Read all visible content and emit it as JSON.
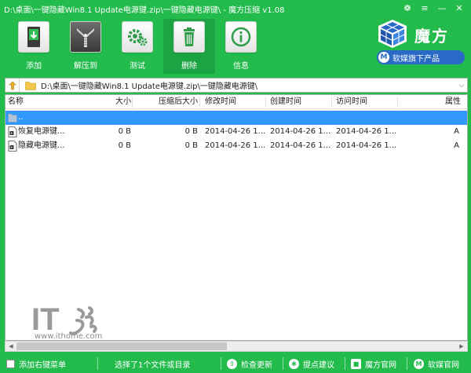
{
  "window": {
    "title": "D:\\桌面\\一键隐藏Win8.1 Update电源键.zip\\一键隐藏电源键\\ - 魔方压缩 v1.08",
    "controls": {
      "skin": "❁",
      "menu": "≡",
      "minimize": "—",
      "close": "✕"
    }
  },
  "toolbar": {
    "items": [
      {
        "id": "add",
        "label": "添加",
        "icon": "add-archive-icon"
      },
      {
        "id": "extract",
        "label": "解压到",
        "icon": "zip-extract-icon"
      },
      {
        "id": "test",
        "label": "测试",
        "icon": "gears-icon"
      },
      {
        "id": "delete",
        "label": "删除",
        "icon": "trash-icon",
        "active": true
      },
      {
        "id": "info",
        "label": "信息",
        "icon": "info-icon"
      }
    ]
  },
  "brand": {
    "name": "魔方",
    "badge": "软媒旗下产品",
    "badge_logo": "M"
  },
  "address": {
    "path": "D:\\桌面\\一键隐藏Win8.1 Update电源键.zip\\一键隐藏电源键\\"
  },
  "list": {
    "columns": [
      "名称",
      "大小",
      "压缩后大小",
      "修改时间",
      "创建时间",
      "访问时间",
      "属性"
    ],
    "rows": [
      {
        "name": "..",
        "size": "",
        "packed": "",
        "modified": "",
        "created": "",
        "accessed": "",
        "attr": "",
        "selected": true,
        "icon": "parent-folder-icon"
      },
      {
        "name": "恢复电源键...",
        "size": "0 B",
        "packed": "0 B",
        "modified": "2014-04-26 1...",
        "created": "2014-04-26 1...",
        "accessed": "2014-04-26 1...",
        "attr": "A",
        "selected": false,
        "icon": "file-icon"
      },
      {
        "name": "隐藏电源键...",
        "size": "0 B",
        "packed": "0 B",
        "modified": "2014-04-26 1...",
        "created": "2014-04-26 1...",
        "accessed": "2014-04-26 1...",
        "attr": "A",
        "selected": false,
        "icon": "file-icon"
      }
    ]
  },
  "watermark": {
    "logo_text": "IT",
    "url": "www.ithome.com"
  },
  "status": {
    "context_menu": "添加右键菜单",
    "selection": "选择了1个文件或目录",
    "check_update": "检查更新",
    "feedback": "提点建议",
    "official_site": "魔方官网",
    "ruanmei_site": "软媒官网"
  },
  "colors": {
    "accent": "#22bb4c",
    "selection": "#3399ff",
    "badge": "#2a69c5"
  }
}
